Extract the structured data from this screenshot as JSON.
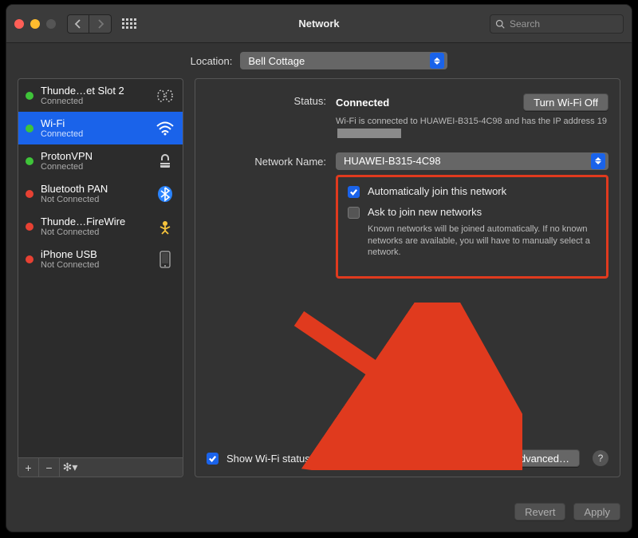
{
  "window": {
    "title": "Network"
  },
  "search": {
    "placeholder": "Search"
  },
  "location": {
    "label": "Location:",
    "value": "Bell Cottage"
  },
  "sidebar": {
    "services": [
      {
        "name": "Thunde…et Slot 2",
        "sub": "Connected",
        "status": "green",
        "icon": "thunderbolt-bridge-icon"
      },
      {
        "name": "Wi-Fi",
        "sub": "Connected",
        "status": "green",
        "icon": "wifi-icon",
        "selected": true
      },
      {
        "name": "ProtonVPN",
        "sub": "Connected",
        "status": "green",
        "icon": "lock-icon"
      },
      {
        "name": "Bluetooth PAN",
        "sub": "Not Connected",
        "status": "red",
        "icon": "bluetooth-icon"
      },
      {
        "name": "Thunde…FireWire",
        "sub": "Not Connected",
        "status": "red",
        "icon": "firewire-icon"
      },
      {
        "name": "iPhone USB",
        "sub": "Not Connected",
        "status": "red",
        "icon": "phone-icon"
      }
    ]
  },
  "status": {
    "label": "Status:",
    "value": "Connected",
    "turn_off": "Turn Wi-Fi Off",
    "desc_prefix": "Wi-Fi is connected to HUAWEI-B315-4C98 and has the IP address 19"
  },
  "network_name": {
    "label": "Network Name:",
    "value": "HUAWEI-B315-4C98"
  },
  "options": {
    "auto_join": {
      "label": "Automatically join this network",
      "checked": true
    },
    "ask_join": {
      "label": "Ask to join new networks",
      "checked": false,
      "desc": "Known networks will be joined automatically. If no known networks are available, you will have to manually select a network."
    }
  },
  "menubar_status": {
    "label": "Show Wi-Fi status in menu bar",
    "checked": true
  },
  "advanced": "Advanced…",
  "footer": {
    "revert": "Revert",
    "apply": "Apply"
  }
}
